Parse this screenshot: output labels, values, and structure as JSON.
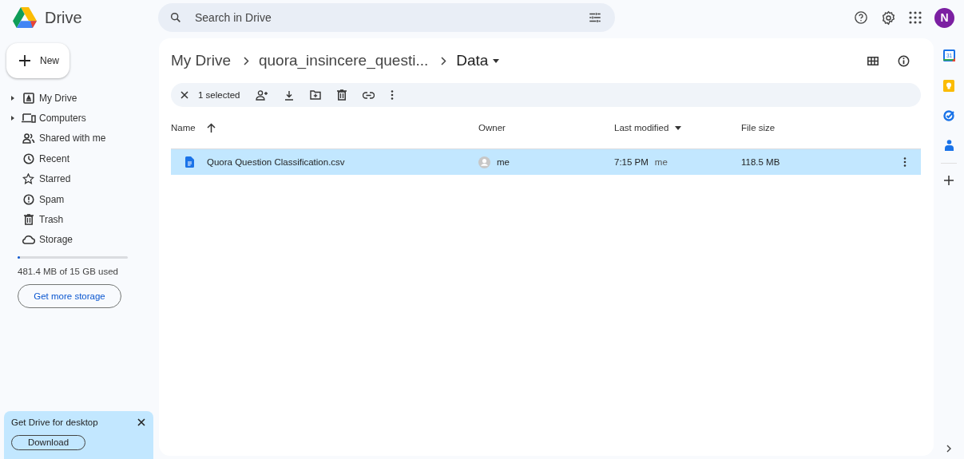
{
  "app": {
    "name": "Drive"
  },
  "search": {
    "placeholder": "Search in Drive"
  },
  "account": {
    "initial": "N",
    "color": "#7b1fa2"
  },
  "new_button": {
    "label": "New"
  },
  "sidebar": {
    "items": [
      {
        "label": "My Drive",
        "kind": "drive",
        "expandable": true
      },
      {
        "label": "Computers",
        "kind": "computer",
        "expandable": true
      },
      {
        "label": "Shared with me",
        "kind": "shared",
        "expandable": false
      },
      {
        "label": "Recent",
        "kind": "recent",
        "expandable": false
      },
      {
        "label": "Starred",
        "kind": "star",
        "expandable": false
      },
      {
        "label": "Spam",
        "kind": "spam",
        "expandable": false
      },
      {
        "label": "Trash",
        "kind": "trash",
        "expandable": false
      },
      {
        "label": "Storage",
        "kind": "storage",
        "expandable": false
      }
    ]
  },
  "storage": {
    "level": 0.02,
    "text": "481.4 MB of 15 GB used",
    "button": "Get more storage"
  },
  "promo": {
    "title": "Get Drive for desktop",
    "button": "Download"
  },
  "breadcrumb": [
    {
      "label": "My Drive",
      "current": false
    },
    {
      "label": "quora_insincere_questi...",
      "current": false
    },
    {
      "label": "Data",
      "current": true
    }
  ],
  "selection_bar": {
    "count": "1 selected"
  },
  "table": {
    "columns": [
      {
        "label": "Name",
        "kind": "arrow"
      },
      {
        "label": "Owner",
        "kind": "plain"
      },
      {
        "label": "Last modified",
        "kind": "caret"
      },
      {
        "label": "File size",
        "kind": "plain"
      }
    ],
    "rows": [
      {
        "name": "Quora Question Classification.csv",
        "owner": "me",
        "modified": "7:15 PM",
        "modified_by": "me",
        "size": "118.5 MB",
        "selected": true
      }
    ]
  },
  "side_panel": {
    "calendar_day": "31"
  }
}
